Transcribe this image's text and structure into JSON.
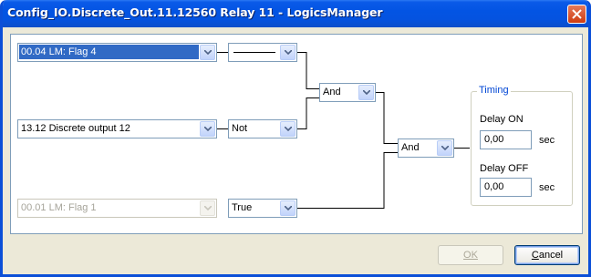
{
  "window": {
    "title": "Config_IO.Discrete_Out.11.12560 Relay 11 - LogicsManager"
  },
  "inputs": [
    {
      "value": "00.04 LM: Flag 4",
      "selected": true,
      "disabled": false
    },
    {
      "value": "13.12 Discrete output 12",
      "selected": false,
      "disabled": false
    },
    {
      "value": "00.01 LM: Flag 1",
      "selected": false,
      "disabled": true
    }
  ],
  "modifiers": [
    {
      "value": ""
    },
    {
      "value": "Not"
    },
    {
      "value": "True"
    }
  ],
  "operators": [
    {
      "value": "And"
    },
    {
      "value": "And"
    }
  ],
  "timing": {
    "legend": "Timing",
    "delay_on_label": "Delay ON",
    "delay_on_value": "0,00",
    "delay_on_unit": "sec",
    "delay_off_label": "Delay OFF",
    "delay_off_value": "0,00",
    "delay_off_unit": "sec"
  },
  "buttons": {
    "ok_label": "OK",
    "ok_enabled": false,
    "cancel_label": "Cancel"
  },
  "colors": {
    "titlebar": "#0354e3",
    "selection": "#316ac5",
    "legend_text": "#0046d5"
  }
}
